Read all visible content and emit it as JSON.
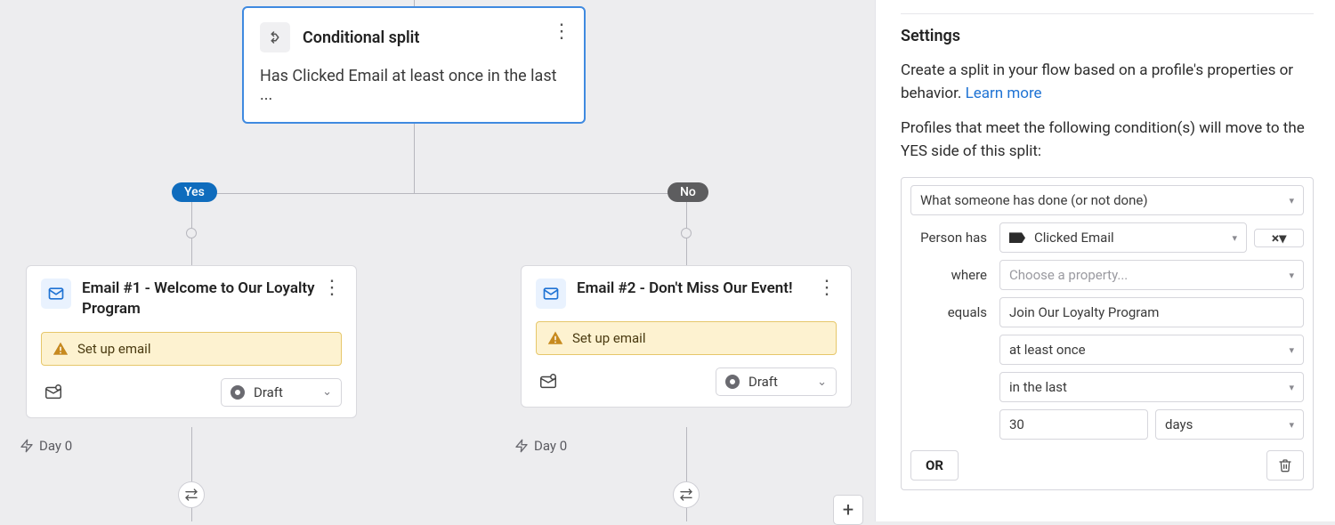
{
  "canvas": {
    "conditional": {
      "title": "Conditional split",
      "description": "Has Clicked Email at least once in the last ..."
    },
    "branches": {
      "yes_label": "Yes",
      "no_label": "No"
    },
    "emails": [
      {
        "title": "Email #1 - Welcome to Our Loyalty Program",
        "warn_label": "Set up email",
        "status_label": "Draft",
        "day_label": "Day 0"
      },
      {
        "title": "Email #2 - Don't Miss Our Event!",
        "warn_label": "Set up email",
        "status_label": "Draft",
        "day_label": "Day 0"
      }
    ]
  },
  "sidebar": {
    "settings_heading": "Settings",
    "description": "Create a split in your flow based on a profile's properties or behavior.",
    "learn_more_label": "Learn more",
    "condition_intro": "Profiles that meet the following condition(s) will move to the YES side of this split:",
    "condition": {
      "type_label": "What someone has done (or not done)",
      "person_has_label": "Person has",
      "event_label": "Clicked Email",
      "where_label": "where",
      "property_placeholder": "Choose a property...",
      "equals_label": "equals",
      "equals_value": "Join Our Loyalty Program",
      "frequency_label": "at least once",
      "timeframe_mode": "in the last",
      "timeframe_value": "30",
      "timeframe_unit": "days",
      "or_label": "OR"
    }
  }
}
